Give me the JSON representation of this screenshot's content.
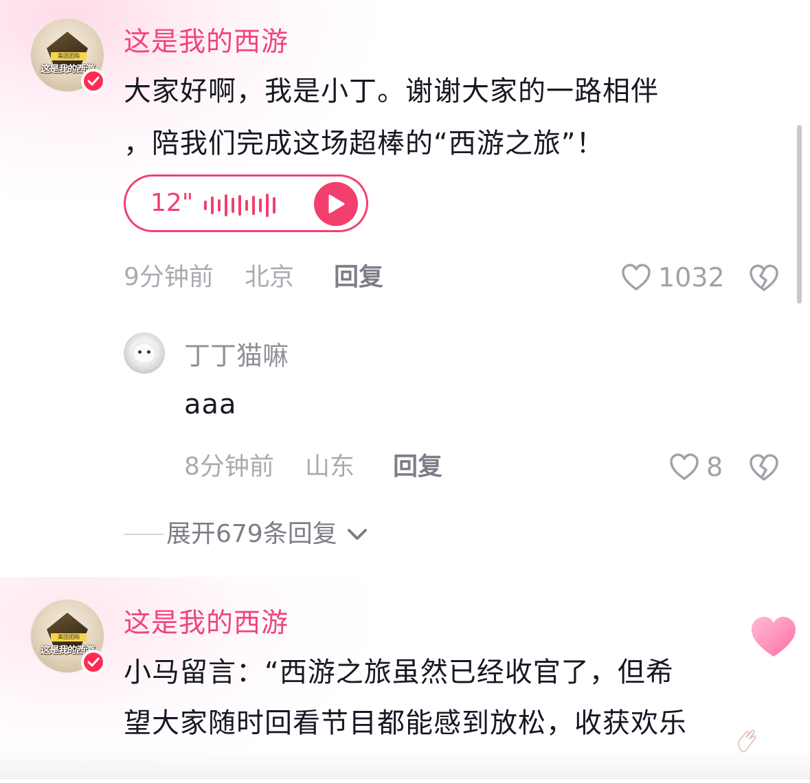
{
  "colors": {
    "accent": "#f0447c",
    "voice_accent": "#f23f6e",
    "text": "#161823",
    "meta": "#a9abb1",
    "verified": "#fe2c55"
  },
  "comment1": {
    "author": "这是我的西游",
    "avatar_badge": "美团团购",
    "avatar_logo": "这是我的西游",
    "text_line1": "大家好啊，我是小丁。谢谢大家的一路相伴",
    "text_line2": "，陪我们完成这场超棒的“西游之旅”！",
    "voice_duration": "12\"",
    "time": "9分钟前",
    "location": "北京",
    "reply_label": "回复",
    "like_count": "1032"
  },
  "reply1": {
    "author": "丁丁猫嘛",
    "text": "aaa",
    "time": "8分钟前",
    "location": "山东",
    "reply_label": "回复",
    "like_count": "8"
  },
  "expand": {
    "label": "展开679条回复"
  },
  "comment2": {
    "author": "这是我的西游",
    "avatar_badge": "美团团购",
    "avatar_logo": "这是我的西游",
    "text_line1": "小马留言：“西游之旅虽然已经收官了，但希",
    "text_line2": "望大家随时回看节目都能感到放松，收获欢乐"
  },
  "icons": {
    "like": "heart-outline-icon",
    "dislike": "broken-heart-icon",
    "play": "play-icon",
    "expand": "chevron-down-icon",
    "verified": "check-badge-icon"
  }
}
